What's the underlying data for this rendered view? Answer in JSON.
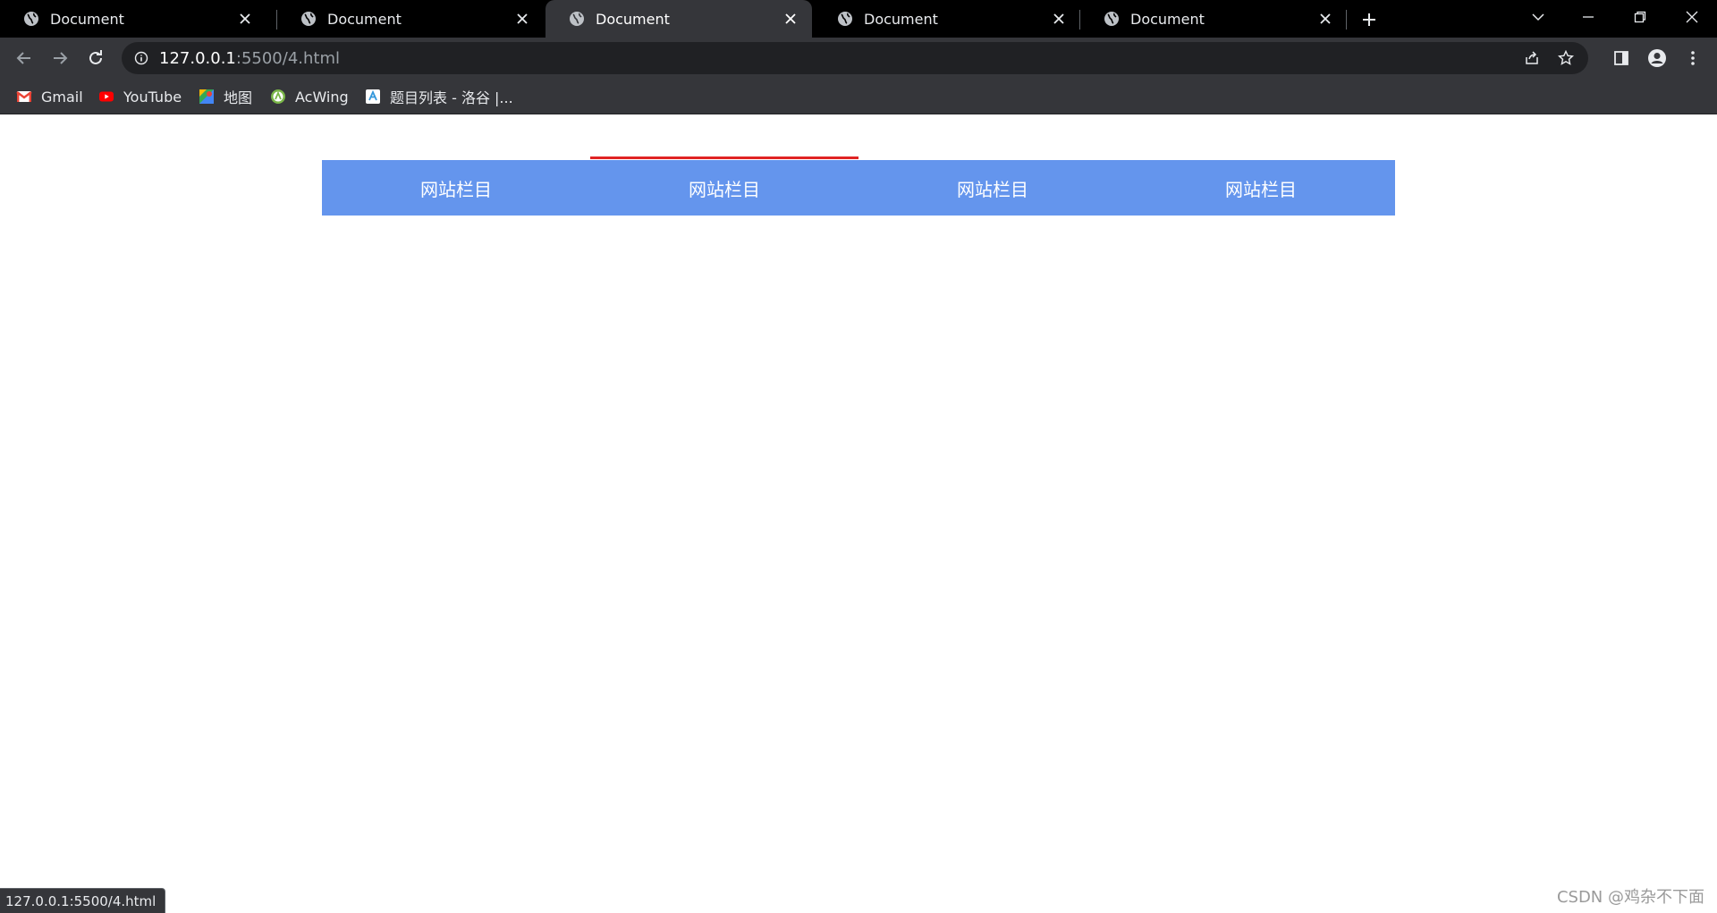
{
  "tabs": [
    {
      "title": "Document",
      "active": false
    },
    {
      "title": "Document",
      "active": false
    },
    {
      "title": "Document",
      "active": true
    },
    {
      "title": "Document",
      "active": false
    },
    {
      "title": "Document",
      "active": false
    }
  ],
  "address_bar": {
    "host": "127.0.0.1",
    "rest": ":5500/4.html"
  },
  "bookmarks": [
    {
      "label": "Gmail",
      "icon": "gmail-icon"
    },
    {
      "label": "YouTube",
      "icon": "youtube-icon"
    },
    {
      "label": "地图",
      "icon": "maps-icon"
    },
    {
      "label": "AcWing",
      "icon": "acwing-icon"
    },
    {
      "label": "题目列表 - 洛谷 |...",
      "icon": "luogu-icon"
    }
  ],
  "nav": {
    "items": [
      {
        "label": "网站栏目"
      },
      {
        "label": "网站栏目"
      },
      {
        "label": "网站栏目"
      },
      {
        "label": "网站栏目"
      }
    ],
    "hovered_index": 1,
    "background_color": "#6495ed",
    "highlight_color": "#e02424"
  },
  "status_bar": {
    "text": "127.0.0.1:5500/4.html"
  },
  "watermark": {
    "text": "CSDN @鸡杂不下面"
  }
}
